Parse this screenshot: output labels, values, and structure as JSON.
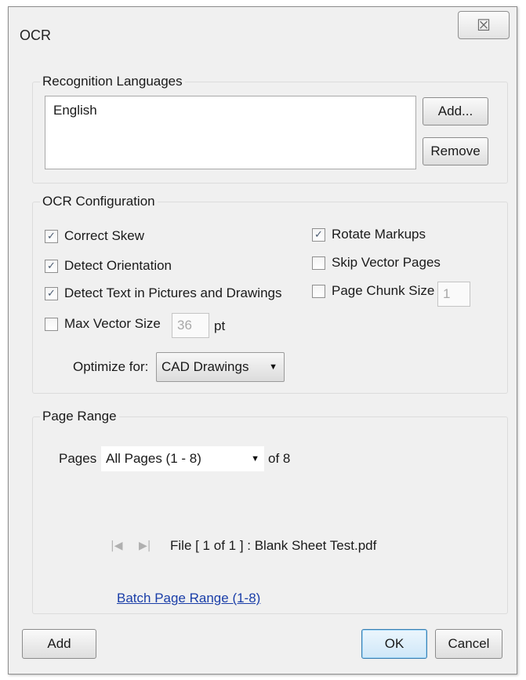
{
  "window": {
    "title": "OCR",
    "close_glyph": "☒"
  },
  "recognition_languages": {
    "group_label": "Recognition Languages",
    "items": [
      "English"
    ],
    "add_label": "Add...",
    "remove_label": "Remove"
  },
  "ocr_config": {
    "group_label": "OCR Configuration",
    "correct_skew": {
      "label": "Correct Skew",
      "checked": true
    },
    "detect_orientation": {
      "label": "Detect Orientation",
      "checked": true
    },
    "detect_text_pictures": {
      "label": "Detect Text in Pictures and Drawings",
      "checked": true
    },
    "max_vector_size": {
      "label": "Max Vector Size",
      "checked": false,
      "value": "36",
      "unit": "pt"
    },
    "rotate_markups": {
      "label": "Rotate Markups",
      "checked": true
    },
    "skip_vector_pages": {
      "label": "Skip Vector Pages",
      "checked": false
    },
    "page_chunk_size": {
      "label": "Page Chunk Size",
      "checked": false,
      "value": "1"
    },
    "optimize_label": "Optimize for:",
    "optimize_value": "CAD Drawings"
  },
  "page_range": {
    "group_label": "Page Range",
    "pages_label": "Pages",
    "pages_value": "All Pages (1 - 8)",
    "of_total": "of 8",
    "file_info": "File [ 1 of 1 ] :  Blank Sheet Test.pdf",
    "batch_link": "Batch Page Range (1-8)"
  },
  "footer": {
    "add_label": "Add",
    "ok_label": "OK",
    "cancel_label": "Cancel"
  },
  "icons": {
    "check": "✓",
    "dropdown": "▼",
    "first_page": "|◀",
    "next_page": "▶|"
  }
}
